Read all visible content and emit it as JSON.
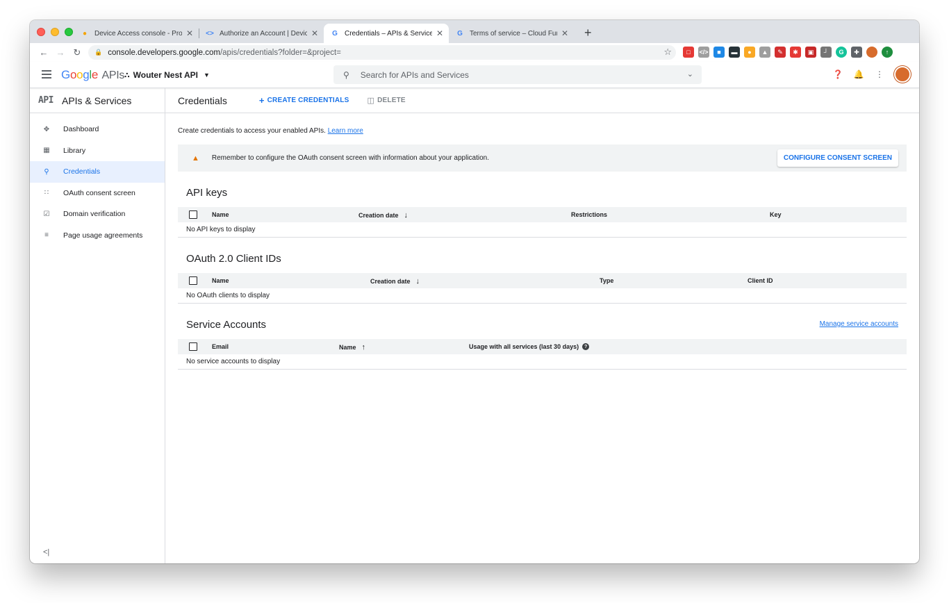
{
  "browser": {
    "tabs": [
      {
        "title": "Device Access console - Project",
        "favicon": "nest-icon",
        "color": "#f4a300",
        "active": false
      },
      {
        "title": "Authorize an Account  |  Device",
        "favicon": "code-icon",
        "color": "#4285f4",
        "active": false
      },
      {
        "title": "Credentials – APIs & Services",
        "favicon": "google-icon",
        "color": "#4285f4",
        "active": true
      },
      {
        "title": "Terms of service – Cloud Functions",
        "favicon": "google-icon",
        "color": "#4285f4",
        "active": false
      }
    ],
    "url_domain": "console.developers.google.com",
    "url_path": "/apis/credentials?folder=&project="
  },
  "header": {
    "logo_google": "Google",
    "logo_apis": "APIs",
    "project_name": "Wouter Nest API",
    "search_placeholder": "Search for APIs and Services"
  },
  "sidebar": {
    "badge": "API",
    "title": "APIs & Services",
    "items": [
      {
        "label": "Dashboard",
        "icon": "dashboard-icon"
      },
      {
        "label": "Library",
        "icon": "library-icon"
      },
      {
        "label": "Credentials",
        "icon": "key-icon"
      },
      {
        "label": "OAuth consent screen",
        "icon": "consent-icon"
      },
      {
        "label": "Domain verification",
        "icon": "checkbox-icon"
      },
      {
        "label": "Page usage agreements",
        "icon": "settings-list-icon"
      }
    ]
  },
  "main": {
    "title": "Credentials",
    "create_label": "CREATE CREDENTIALS",
    "delete_label": "DELETE",
    "intro_text": "Create credentials to access your enabled APIs.",
    "learn_more": "Learn more",
    "banner_text": "Remember to configure the OAuth consent screen with information about your application.",
    "banner_button": "CONFIGURE CONSENT SCREEN",
    "api_keys": {
      "title": "API keys",
      "columns": [
        "Name",
        "Creation date",
        "Restrictions",
        "Key"
      ],
      "empty": "No API keys to display"
    },
    "oauth": {
      "title": "OAuth 2.0 Client IDs",
      "columns": [
        "Name",
        "Creation date",
        "Type",
        "Client ID"
      ],
      "empty": "No OAuth clients to display"
    },
    "service_accounts": {
      "title": "Service Accounts",
      "manage_link": "Manage service accounts",
      "columns": [
        "Email",
        "Name",
        "Usage with all services (last 30 days)"
      ],
      "empty": "No service accounts to display"
    }
  }
}
